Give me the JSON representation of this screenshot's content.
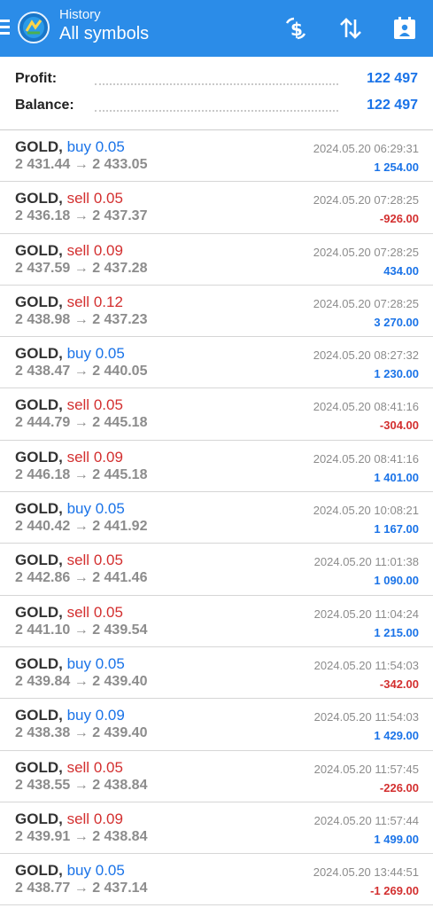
{
  "header": {
    "subtitle": "History",
    "title": "All symbols",
    "icons": [
      "menu-icon",
      "app-logo",
      "currency-sort-icon",
      "sort-icon",
      "calendar-icon"
    ]
  },
  "summary": {
    "profit_label": "Profit:",
    "profit_value": "122 497",
    "balance_label": "Balance:",
    "balance_value": "122 497"
  },
  "colors": {
    "accent": "#2b8ce8",
    "buy": "#1a73e8",
    "sell": "#d32f2f"
  },
  "deals": [
    {
      "symbol": "GOLD",
      "comma": ",",
      "side": "buy",
      "volume": "0.05",
      "open": "2 431.44",
      "close": "2 433.05",
      "time": "2024.05.20 06:29:31",
      "profit": "1 254.00"
    },
    {
      "symbol": "GOLD",
      "comma": ",",
      "side": "sell",
      "volume": "0.05",
      "open": "2 436.18",
      "close": "2 437.37",
      "time": "2024.05.20 07:28:25",
      "profit": "-926.00"
    },
    {
      "symbol": "GOLD",
      "comma": ",",
      "side": "sell",
      "volume": "0.09",
      "open": "2 437.59",
      "close": "2 437.28",
      "time": "2024.05.20 07:28:25",
      "profit": "434.00"
    },
    {
      "symbol": "GOLD",
      "comma": ",",
      "side": "sell",
      "volume": "0.12",
      "open": "2 438.98",
      "close": "2 437.23",
      "time": "2024.05.20 07:28:25",
      "profit": "3 270.00"
    },
    {
      "symbol": "GOLD",
      "comma": ",",
      "side": "buy",
      "volume": "0.05",
      "open": "2 438.47",
      "close": "2 440.05",
      "time": "2024.05.20 08:27:32",
      "profit": "1 230.00"
    },
    {
      "symbol": "GOLD",
      "comma": ",",
      "side": "sell",
      "volume": "0.05",
      "open": "2 444.79",
      "close": "2 445.18",
      "time": "2024.05.20 08:41:16",
      "profit": "-304.00"
    },
    {
      "symbol": "GOLD",
      "comma": ",",
      "side": "sell",
      "volume": "0.09",
      "open": "2 446.18",
      "close": "2 445.18",
      "time": "2024.05.20 08:41:16",
      "profit": "1 401.00"
    },
    {
      "symbol": "GOLD",
      "comma": ",",
      "side": "buy",
      "volume": "0.05",
      "open": "2 440.42",
      "close": "2 441.92",
      "time": "2024.05.20 10:08:21",
      "profit": "1 167.00"
    },
    {
      "symbol": "GOLD",
      "comma": ",",
      "side": "sell",
      "volume": "0.05",
      "open": "2 442.86",
      "close": "2 441.46",
      "time": "2024.05.20 11:01:38",
      "profit": "1 090.00"
    },
    {
      "symbol": "GOLD",
      "comma": ",",
      "side": "sell",
      "volume": "0.05",
      "open": "2 441.10",
      "close": "2 439.54",
      "time": "2024.05.20 11:04:24",
      "profit": "1 215.00"
    },
    {
      "symbol": "GOLD",
      "comma": ",",
      "side": "buy",
      "volume": "0.05",
      "open": "2 439.84",
      "close": "2 439.40",
      "time": "2024.05.20 11:54:03",
      "profit": "-342.00"
    },
    {
      "symbol": "GOLD",
      "comma": ",",
      "side": "buy",
      "volume": "0.09",
      "open": "2 438.38",
      "close": "2 439.40",
      "time": "2024.05.20 11:54:03",
      "profit": "1 429.00"
    },
    {
      "symbol": "GOLD",
      "comma": ",",
      "side": "sell",
      "volume": "0.05",
      "open": "2 438.55",
      "close": "2 438.84",
      "time": "2024.05.20 11:57:45",
      "profit": "-226.00"
    },
    {
      "symbol": "GOLD",
      "comma": ",",
      "side": "sell",
      "volume": "0.09",
      "open": "2 439.91",
      "close": "2 438.84",
      "time": "2024.05.20 11:57:44",
      "profit": "1 499.00"
    },
    {
      "symbol": "GOLD",
      "comma": ",",
      "side": "buy",
      "volume": "0.05",
      "open": "2 438.77",
      "close": "2 437.14",
      "time": "2024.05.20 13:44:51",
      "profit": "-1 269.00"
    }
  ]
}
